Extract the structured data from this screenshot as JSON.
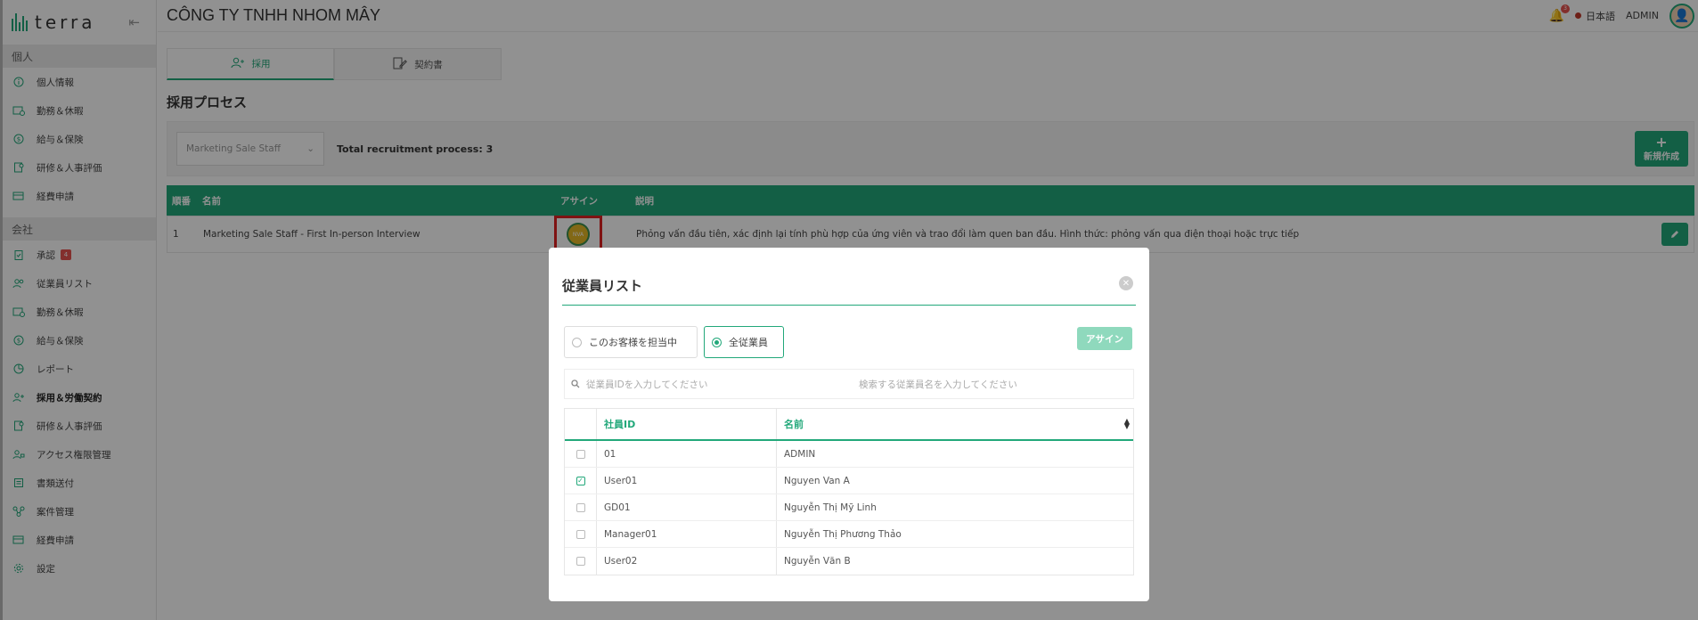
{
  "app": {
    "logo": "terra",
    "company": "CÔNG TY TNHH NHOM MÂY"
  },
  "topbar": {
    "notifications": "3",
    "language": "日本語",
    "user": "ADMIN"
  },
  "sidebar": {
    "personal_header": "個人",
    "personal_items": [
      {
        "label": "個人情報",
        "icon": "info-icon"
      },
      {
        "label": "勤務＆休暇",
        "icon": "work-icon"
      },
      {
        "label": "給与＆保険",
        "icon": "money-icon"
      },
      {
        "label": "研修＆人事評価",
        "icon": "training-icon"
      },
      {
        "label": "経費申請",
        "icon": "expense-icon"
      }
    ],
    "company_header": "会社",
    "company_items": [
      {
        "label": "承認",
        "icon": "approval-icon",
        "badge": "4"
      },
      {
        "label": "従業員リスト",
        "icon": "employees-icon"
      },
      {
        "label": "勤務＆休暇",
        "icon": "work-icon"
      },
      {
        "label": "給与＆保険",
        "icon": "money-icon"
      },
      {
        "label": "レポート",
        "icon": "report-icon"
      },
      {
        "label": "採用＆労働契約",
        "icon": "recruit-icon"
      },
      {
        "label": "研修＆人事評価",
        "icon": "training-icon"
      },
      {
        "label": "アクセス権限管理",
        "icon": "access-icon"
      },
      {
        "label": "書類送付",
        "icon": "document-icon"
      },
      {
        "label": "案件管理",
        "icon": "project-icon"
      },
      {
        "label": "経費申請",
        "icon": "expense-icon"
      },
      {
        "label": "設定",
        "icon": "gear-icon"
      }
    ]
  },
  "tabs": [
    {
      "label": "採用"
    },
    {
      "label": "契約書"
    }
  ],
  "page_title": "採用プロセス",
  "filter": {
    "selected": "Marketing Sale Staff",
    "total": "Total recruitment process: 3",
    "new_label": "新規作成"
  },
  "process_table": {
    "headers": {
      "no": "順番",
      "name": "名前",
      "assign": "アサイン",
      "desc": "説明"
    },
    "rows": [
      {
        "no": "1",
        "name": "Marketing Sale Staff - First In-person Interview",
        "assignee_initials": "NVA",
        "desc": "Phỏng vấn đầu tiên, xác định lại tính phù hợp của ứng viên và trao đổi làm quen ban đầu. Hình thức: phỏng vấn qua điện thoại hoặc trực tiếp"
      }
    ]
  },
  "modal": {
    "title": "従業員リスト",
    "option_assigned": "このお客様を担当中",
    "option_all": "全従業員",
    "assign_label": "アサイン",
    "search_id_placeholder": "従業員IDを入力してください",
    "search_name_placeholder": "検索する従業員名を入力してください",
    "col_id": "社員ID",
    "col_name": "名前",
    "rows": [
      {
        "id": "01",
        "name": "ADMIN",
        "checked": false
      },
      {
        "id": "User01",
        "name": "Nguyen Van A",
        "checked": true
      },
      {
        "id": "GD01",
        "name": "Nguyễn Thị Mỹ Linh",
        "checked": false
      },
      {
        "id": "Manager01",
        "name": "Nguyễn Thị Phương Thảo",
        "checked": false
      },
      {
        "id": "User02",
        "name": "Nguyễn Văn B",
        "checked": false
      }
    ]
  },
  "colors": {
    "accent": "#22a87a",
    "highlight": "#e02020",
    "badge": "#e6544f"
  }
}
